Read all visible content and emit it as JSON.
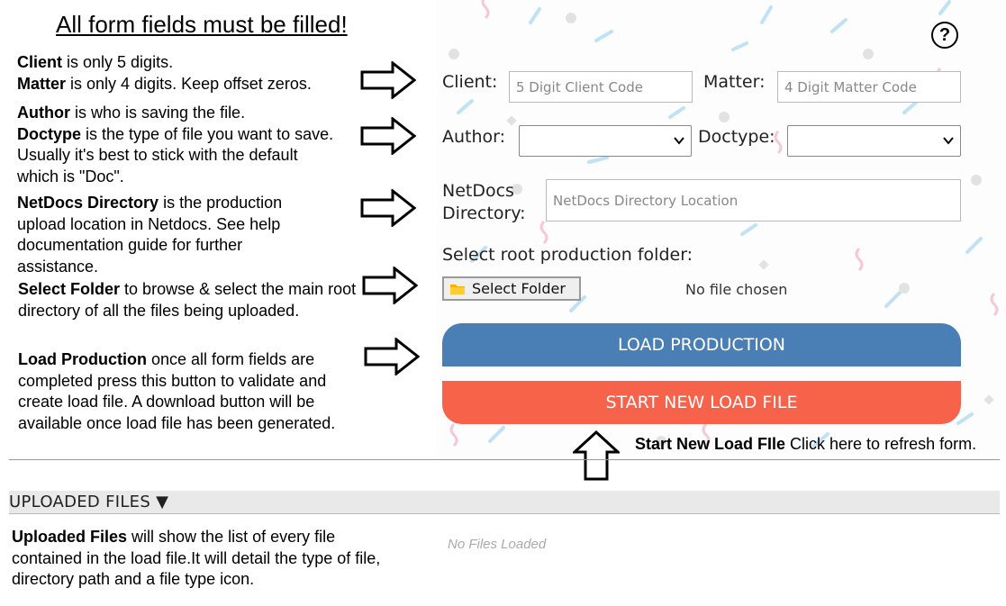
{
  "instructions": {
    "title": "All form fields must be filled!",
    "client_bold": "Client",
    "client_text": " is only 5 digits.",
    "matter_bold": "Matter",
    "matter_text": " is only 4 digits. Keep offset zeros.",
    "author_bold": "Author",
    "author_text": " is who is saving the file.",
    "doctype_bold": "Doctype",
    "doctype_text": " is the type of file you want to save. Usually it's best to stick with the default which is \"Doc\".",
    "netdocs_bold": "NetDocs Directory",
    "netdocs_text": " is the production upload location in Netdocs. See help documentation guide for further assistance.",
    "folder_bold": "Select Folder",
    "folder_text": " to browse & select the main root directory of all the files being uploaded.",
    "load_bold": "Load Production",
    "load_text": " once all form fields are completed press this button to validate and create load file. A download button will be available once load file has been generated.",
    "newload_bold": "Start New Load FIle",
    "newload_text": " Click here to refresh form.",
    "uploaded_bold": "Uploaded Files",
    "uploaded_text": " will show the list of every file contained in the load file.It will detail the type of file, directory path and a file type icon."
  },
  "form": {
    "help_symbol": "?",
    "client_label": "Client:",
    "client_placeholder": "5 Digit Client Code",
    "matter_label": "Matter:",
    "matter_placeholder": "4 Digit Matter Code",
    "author_label": "Author:",
    "author_value": "",
    "doctype_label": "Doctype:",
    "doctype_value": "",
    "netdocs_label_line1": "NetDocs",
    "netdocs_label_line2": "Directory:",
    "netdocs_placeholder": "NetDocs Directory Location",
    "root_folder_label": "Select root production folder:",
    "select_folder_button": "Select Folder",
    "no_file_text": "No file chosen",
    "load_button": "LOAD PRODUCTION",
    "new_button": "START NEW LOAD FILE"
  },
  "uploaded": {
    "header": "UPLOADED FILES ▼",
    "empty_text": "No Files Loaded"
  },
  "colors": {
    "load_button": "#4a7fb5",
    "new_button": "#f7624b"
  }
}
